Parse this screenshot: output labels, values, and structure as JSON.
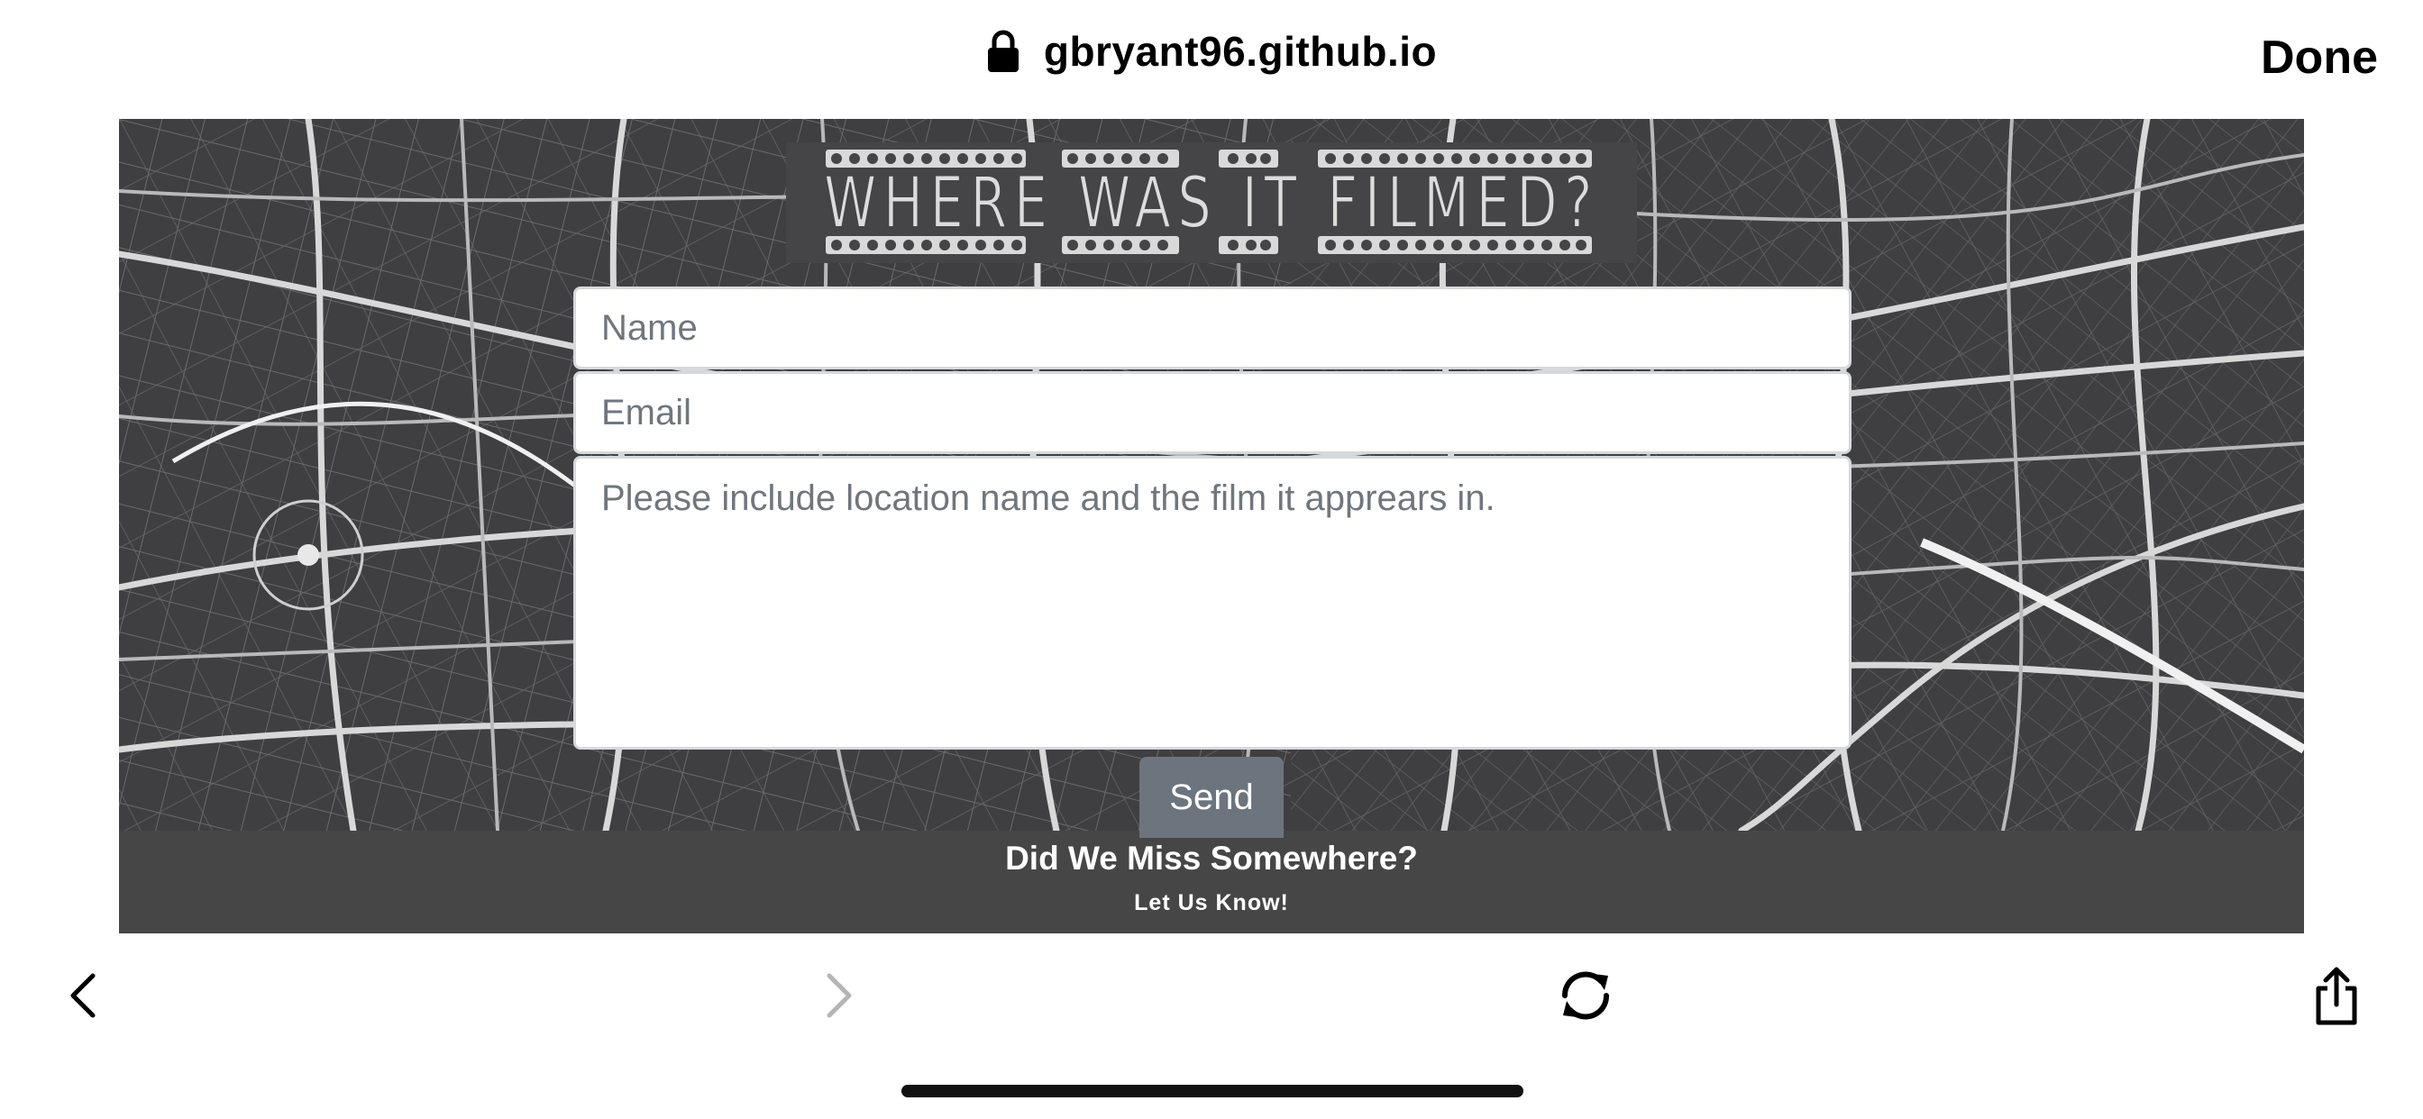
{
  "browser": {
    "url": "gbryant96.github.io",
    "done_label": "Done"
  },
  "site": {
    "logo_text": "WHERE WAS IT FILMED?",
    "form": {
      "name_placeholder": "Name",
      "email_placeholder": "Email",
      "message_placeholder": "Please include location name and the film it apprears in.",
      "send_label": "Send"
    },
    "footer": {
      "title": "Did We Miss Somewhere?",
      "subtitle": "Let Us Know!"
    }
  },
  "toolbar": {
    "icons": [
      "back-icon",
      "forward-icon",
      "reload-icon",
      "share-icon"
    ],
    "forward_enabled": false
  },
  "colors": {
    "map_background": "#3f3f41",
    "footer_background": "#464646",
    "send_button": "#6c757d",
    "placeholder_text": "#70767d"
  }
}
